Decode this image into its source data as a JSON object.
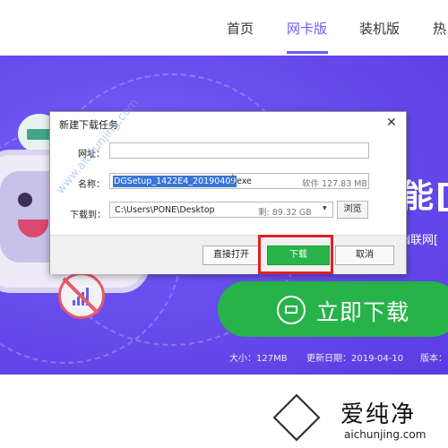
{
  "nav": {
    "items": [
      "首页",
      "网卡版",
      "装机版",
      "热"
    ],
    "active_index": 1,
    "accent": "#6a5df3"
  },
  "hero": {
    "headline_fragment": "能[",
    "sub_fragment": "幽联网[",
    "download_label": "立即下载",
    "button_color": "#27b24a",
    "meta": {
      "size": "大小：127MB",
      "date": "更新日期：2019-04-10",
      "version": "版本："
    }
  },
  "dialog": {
    "title": "新建下载任务",
    "close_glyph": "✕",
    "url_label": "网址：",
    "url_value": "",
    "name_label": "名称：",
    "name_selected": "DGSetup_1422E4_20190409",
    "name_ext": ".exe",
    "name_meta": "软件 127.83 MB",
    "path_label": "下载到：",
    "path_value": "C:\\Users\\PONE\\Desktop",
    "free_space": "剩: 89.32 GB",
    "browse_label": "浏览",
    "buttons": {
      "open_direct": "直接打开",
      "download": "下载",
      "cancel": "取消"
    },
    "highlight_color": "#e21f26"
  },
  "watermark": {
    "diagonal": "www.aichunjing.com",
    "logo_text": "爱纯净",
    "logo_url": "aichunjing.com"
  }
}
